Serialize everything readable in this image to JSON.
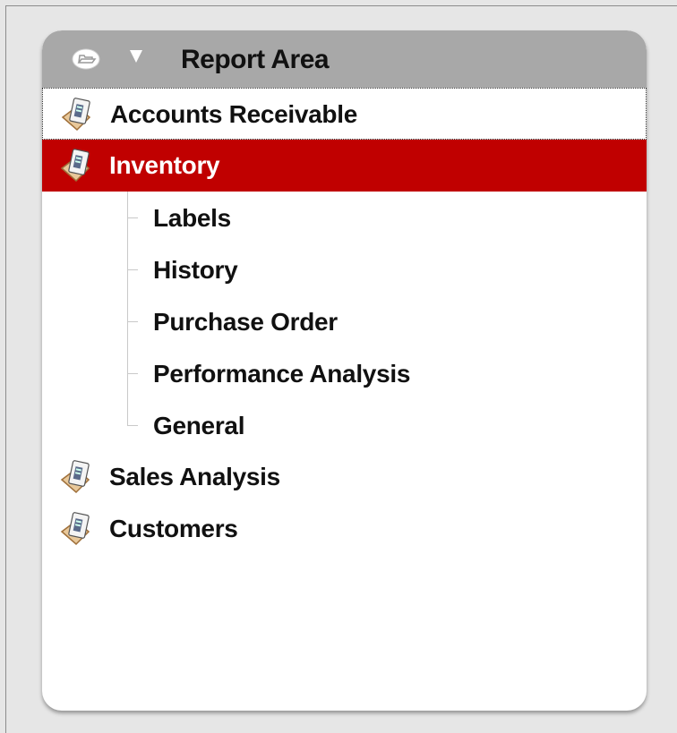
{
  "panel": {
    "title": "Report Area",
    "icons": {
      "folder": "folder-open-icon",
      "toggle": "collapse-arrow-icon",
      "report": "report-clipboard-icon"
    }
  },
  "tree": {
    "items": [
      {
        "label": "Accounts Receivable",
        "state": "hovered"
      },
      {
        "label": "Inventory",
        "state": "selected",
        "expanded": true,
        "children": [
          {
            "label": "Labels"
          },
          {
            "label": "History"
          },
          {
            "label": "Purchase Order"
          },
          {
            "label": "Performance Analysis"
          },
          {
            "label": "General"
          }
        ]
      },
      {
        "label": "Sales Analysis",
        "state": "normal"
      },
      {
        "label": "Customers",
        "state": "normal"
      }
    ]
  },
  "colors": {
    "header": "#a8a8a8",
    "selected": "#c00000",
    "background": "#e6e6e6"
  }
}
